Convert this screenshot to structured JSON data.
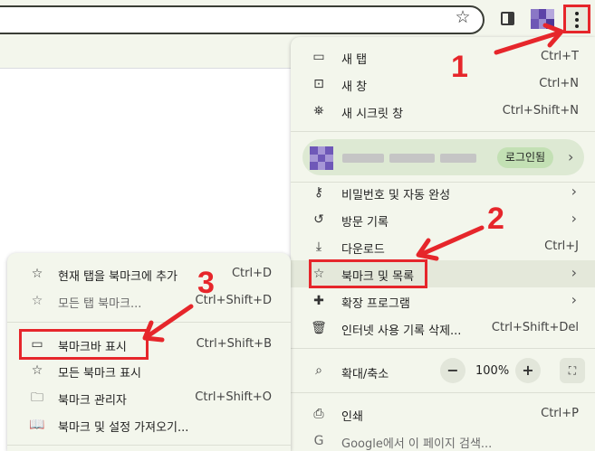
{
  "menu": {
    "items": [
      {
        "label": "새 탭",
        "shortcut": "Ctrl+T",
        "icon": "new-tab-icon"
      },
      {
        "label": "새 창",
        "shortcut": "Ctrl+N",
        "icon": "new-window-icon"
      },
      {
        "label": "새 시크릿 창",
        "shortcut": "Ctrl+Shift+N",
        "icon": "incognito-icon"
      }
    ],
    "profile": {
      "login_label": "로그인됨"
    },
    "items2": [
      {
        "label": "비밀번호 및 자동 완성",
        "shortcut": "",
        "icon": "key-icon"
      },
      {
        "label": "방문 기록",
        "shortcut": "",
        "icon": "history-icon"
      },
      {
        "label": "다운로드",
        "shortcut": "Ctrl+J",
        "icon": "download-icon"
      },
      {
        "label": "북마크 및 목록",
        "shortcut": "",
        "icon": "star-icon"
      },
      {
        "label": "확장 프로그램",
        "shortcut": "",
        "icon": "puzzle-icon"
      },
      {
        "label": "인터넷 사용 기록 삭제...",
        "shortcut": "Ctrl+Shift+Del",
        "icon": "trash-icon"
      }
    ],
    "zoom": {
      "label": "확대/축소",
      "minus": "−",
      "value": "100%",
      "plus": "+"
    },
    "items3": [
      {
        "label": "인쇄",
        "shortcut": "Ctrl+P",
        "icon": "print-icon"
      },
      {
        "label": "Google에서 이 페이지 검색...",
        "shortcut": "",
        "icon": "google-icon"
      }
    ]
  },
  "submenu": {
    "items": [
      {
        "label": "현재 탭을 북마크에 추가",
        "shortcut": "Ctrl+D"
      },
      {
        "label": "모든 탭 북마크...",
        "shortcut": "Ctrl+Shift+D"
      },
      {
        "label": "북마크바 표시",
        "shortcut": "Ctrl+Shift+B"
      },
      {
        "label": "모든 북마크 표시",
        "shortcut": ""
      },
      {
        "label": "북마크 관리자",
        "shortcut": "Ctrl+Shift+O"
      },
      {
        "label": "북마크 및 설정 가져오기...",
        "shortcut": ""
      }
    ]
  },
  "annotations": {
    "n1": "1",
    "n2": "2",
    "n3": "3"
  },
  "colors": {
    "annotation_red": "#e6262b",
    "menu_bg": "#f3f6ec",
    "signed_in_pill": "#c3e0b4"
  }
}
